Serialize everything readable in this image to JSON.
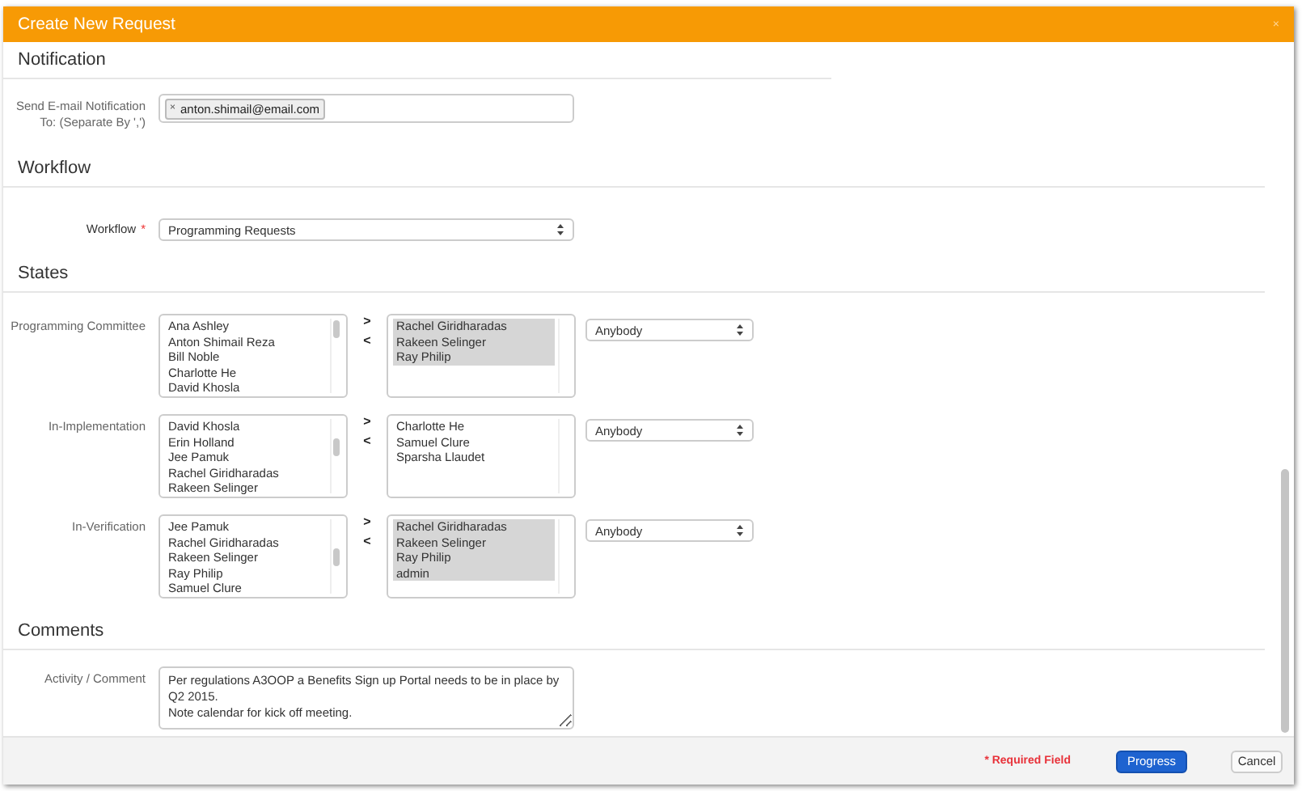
{
  "window": {
    "title": "Create New Request",
    "close": "×"
  },
  "notification": {
    "heading": "Notification",
    "label": "Send E-mail Notification To: (Separate By ',')",
    "tags": [
      {
        "remove": "×",
        "text": "anton.shimail@email.com"
      }
    ]
  },
  "workflow": {
    "heading": "Workflow",
    "label": "Workflow",
    "required_mark": "*",
    "value": "Programming Requests"
  },
  "states": {
    "heading": "States",
    "rows": [
      {
        "label": "Programming Committee",
        "available": [
          {
            "text": "Ana Ashley"
          },
          {
            "text": "Anton Shimail Reza"
          },
          {
            "text": "Bill Noble"
          },
          {
            "text": "Charlotte He"
          },
          {
            "text": "David Khosla"
          }
        ],
        "move_right": ">",
        "move_left": "<",
        "assigned": [
          {
            "text": "Rachel Giridharadas",
            "selected": true
          },
          {
            "text": "Rakeen Selinger",
            "selected": true
          },
          {
            "text": "Ray Philip",
            "selected": true
          }
        ],
        "assignee": "Anybody"
      },
      {
        "label": "In-Implementation",
        "available": [
          {
            "text": "David Khosla"
          },
          {
            "text": "Erin Holland"
          },
          {
            "text": "Jee Pamuk"
          },
          {
            "text": "Rachel Giridharadas"
          },
          {
            "text": "Rakeen Selinger"
          }
        ],
        "move_right": ">",
        "move_left": "<",
        "assigned": [
          {
            "text": "Charlotte He",
            "selected": false
          },
          {
            "text": "Samuel Clure",
            "selected": false
          },
          {
            "text": "Sparsha Llaudet",
            "selected": false
          }
        ],
        "assignee": "Anybody"
      },
      {
        "label": "In-Verification",
        "available": [
          {
            "text": "Jee Pamuk"
          },
          {
            "text": "Rachel Giridharadas"
          },
          {
            "text": "Rakeen Selinger"
          },
          {
            "text": "Ray Philip"
          },
          {
            "text": "Samuel Clure"
          }
        ],
        "move_right": ">",
        "move_left": "<",
        "assigned": [
          {
            "text": "Rachel Giridharadas",
            "selected": true
          },
          {
            "text": "Rakeen Selinger",
            "selected": true
          },
          {
            "text": "Ray Philip",
            "selected": true
          },
          {
            "text": "admin",
            "selected": true
          }
        ],
        "assignee": "Anybody"
      }
    ]
  },
  "comments": {
    "heading": "Comments",
    "label": "Activity / Comment",
    "value": "Per regulations A3OOP a Benefits Sign up Portal needs to be in place by Q2 2015.\nNote calendar for kick off meeting."
  },
  "footer": {
    "required_note": "* Required Field",
    "buttons": [
      {
        "kind": "primary",
        "label": "Progress"
      },
      {
        "kind": "default",
        "label": "Cancel"
      }
    ]
  }
}
